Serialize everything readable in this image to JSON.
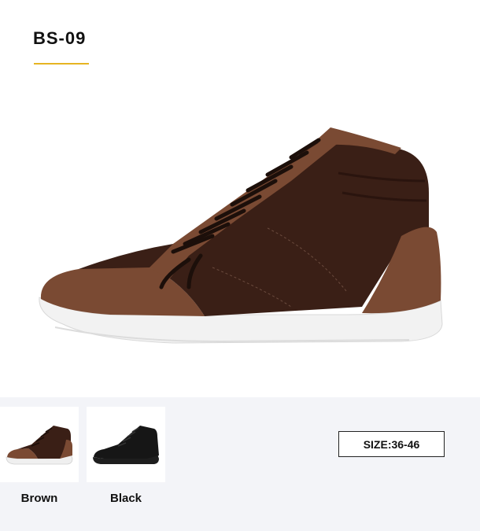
{
  "product": {
    "title": "BS-09",
    "size_label": "SIZE:36-46"
  },
  "colors": {
    "accent": "#e6b422",
    "brown_canvas": "#3a1f16",
    "brown_suede": "#7a4a33",
    "sole": "#f0f0f0"
  },
  "variants": [
    {
      "label": "Brown",
      "icon": "brown-sneaker-thumbnail"
    },
    {
      "label": "Black",
      "icon": "black-sneaker-thumbnail"
    }
  ]
}
